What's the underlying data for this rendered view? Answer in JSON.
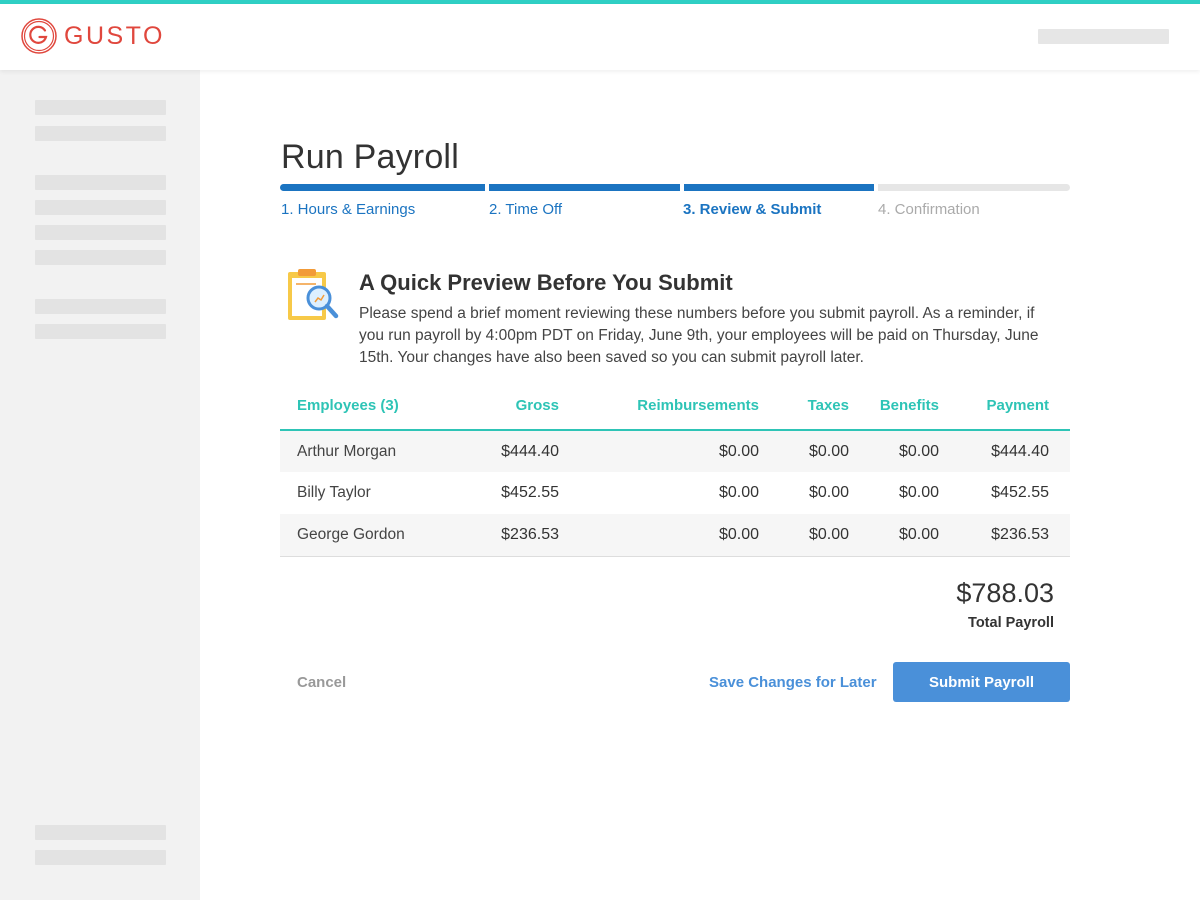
{
  "brand": {
    "name": "GUSTO",
    "color": "#e0473d",
    "accent": "#2fcfc4",
    "logo_icon": "gusto-g-icon"
  },
  "page": {
    "title": "Run Payroll"
  },
  "steps": [
    {
      "label": "1. Hours & Earnings",
      "state": "done"
    },
    {
      "label": "2. Time Off",
      "state": "done"
    },
    {
      "label": "3. Review & Submit",
      "state": "current"
    },
    {
      "label": "4. Confirmation",
      "state": "todo"
    }
  ],
  "preview": {
    "icon": "clipboard-magnifier-icon",
    "heading": "A Quick Preview Before You Submit",
    "text": "Please spend a brief moment reviewing these numbers before you submit payroll. As a reminder, if you run payroll by 4:00pm PDT on Friday, June 9th, your employees will be paid on Thursday, June 15th. Your changes have also been saved so you can submit payroll later."
  },
  "table": {
    "headers": [
      "Employees (3)",
      "Gross",
      "Reimbursements",
      "Taxes",
      "Benefits",
      "Payment"
    ],
    "rows": [
      [
        "Arthur Morgan",
        "$444.40",
        "$0.00",
        "$0.00",
        "$0.00",
        "$444.40"
      ],
      [
        "Billy Taylor",
        "$452.55",
        "$0.00",
        "$0.00",
        "$0.00",
        "$452.55"
      ],
      [
        "George Gordon",
        "$236.53",
        "$0.00",
        "$0.00",
        "$0.00",
        "$236.53"
      ]
    ]
  },
  "total": {
    "amount": "$788.03",
    "label": "Total Payroll"
  },
  "actions": {
    "cancel": "Cancel",
    "save": "Save Changes for Later",
    "submit": "Submit Payroll"
  },
  "colors": {
    "step_done": "#1b74c1",
    "table_header": "#2ec4b6",
    "primary_button": "#4a90d9"
  }
}
